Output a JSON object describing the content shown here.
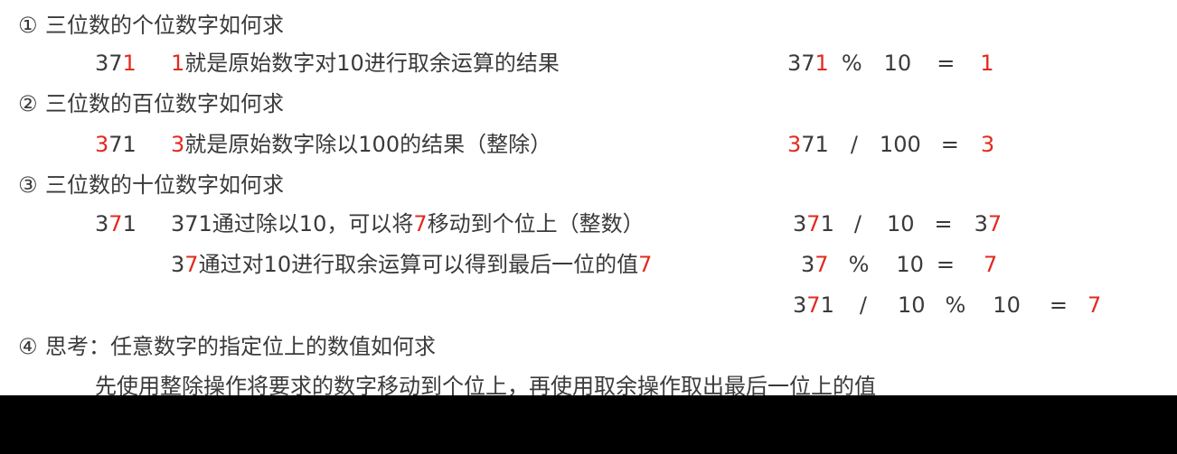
{
  "accent_red": "#e02b20",
  "q1": {
    "num": "①",
    "heading": "三位数的个位数字如何求",
    "example_a": "37",
    "example_b": "1",
    "desc_a": "1",
    "desc_b": "就是原始数字对10进行取余运算的结果",
    "expr_a": "37",
    "expr_b": "1",
    "expr_c": "%",
    "expr_d": "10",
    "expr_e": "=",
    "expr_f": "1"
  },
  "q2": {
    "num": "②",
    "heading": "三位数的百位数字如何求",
    "example_a": "3",
    "example_b": "71",
    "desc_a": "3",
    "desc_b": "就是原始数字除以100的结果（整除）",
    "expr_a": "3",
    "expr_b": "71",
    "expr_c": "/",
    "expr_d": "100",
    "expr_e": "=",
    "expr_f": "3"
  },
  "q3": {
    "num": "③",
    "heading": "三位数的十位数字如何求",
    "example_a": "3",
    "example_b": "7",
    "example_c": "1",
    "line1_a": "371通过除以10，可以将",
    "line1_b": "7",
    "line1_c": "移动到个位上（整数）",
    "expr1_a": "3",
    "expr1_b": "7",
    "expr1_c": "1",
    "expr1_d": "/",
    "expr1_e": "10",
    "expr1_f": "=",
    "expr1_g": "3",
    "expr1_h": "7",
    "line2_a": "3",
    "line2_b": "7",
    "line2_c": "通过对10进行取余运算可以得到最后一位的值",
    "line2_d": "7",
    "expr2_a": "3",
    "expr2_b": "7",
    "expr2_c": "%",
    "expr2_d": "10",
    "expr2_e": "=",
    "expr2_f": "7",
    "expr3_a": "3",
    "expr3_b": "7",
    "expr3_c": "1",
    "expr3_d": "/",
    "expr3_e": "10",
    "expr3_f": "%",
    "expr3_g": "10",
    "expr3_h": "=",
    "expr3_i": "7"
  },
  "q4": {
    "num": "④",
    "heading": "思考：任意数字的指定位上的数值如何求",
    "answer": "先使用整除操作将要求的数字移动到个位上，再使用取余操作取出最后一位上的值"
  }
}
